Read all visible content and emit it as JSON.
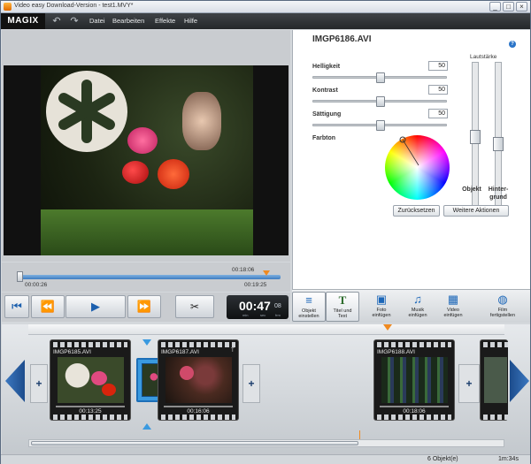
{
  "window": {
    "title": "Video easy Download-Version - test1.MVY*",
    "controls": [
      "_",
      "□",
      "×"
    ]
  },
  "menubar": {
    "logo": "MAGIX",
    "undo_icon": "undo-icon",
    "redo_icon": "redo-icon",
    "items": [
      "Datei",
      "Bearbeiten",
      "Effekte",
      "Hilfe"
    ]
  },
  "seek": {
    "top_time": "00:18:06",
    "start_time": "00:00:26",
    "end_time": "00:19:25",
    "position": 0.96
  },
  "transport": {
    "buttons": [
      "⏮",
      "⏪",
      "▶",
      "⏩"
    ],
    "icons": [
      "skip-start-icon",
      "rewind-icon",
      "play-icon",
      "fast-forward-icon"
    ],
    "cut_icon": "scissors-icon"
  },
  "lcd": {
    "time": "00:47",
    "frame": "08",
    "labels": [
      "min",
      "sec",
      "frm"
    ]
  },
  "properties": {
    "clip_name": "IMGP6186.AVI",
    "help": "?",
    "sliders": [
      {
        "label": "Helligkeit",
        "value": "50",
        "level": 0.5
      },
      {
        "label": "Kontrast",
        "value": "50",
        "level": 0.5
      },
      {
        "label": "Sättigung",
        "value": "50",
        "level": 0.5
      }
    ],
    "hue_label": "Farbton",
    "volume": {
      "title": "Lautstärke",
      "object_label": "Objekt",
      "bg_label_1": "Hinter-",
      "bg_label_2": "grund",
      "object_level": 0.5,
      "bg_level": 0.45
    },
    "reset_button": "Zurücksetzen",
    "more_button": "Weitere Aktionen"
  },
  "toolbar": {
    "items": [
      {
        "line1": "Objekt",
        "line2": "einstellen",
        "icon": "adjust-icon"
      },
      {
        "line1": "Titel und",
        "line2": "Text",
        "icon": "title-icon"
      },
      {
        "line1": "Foto",
        "line2": "einfügen",
        "icon": "photo-insert-icon"
      },
      {
        "line1": "Musik",
        "line2": "einfügen",
        "icon": "music-insert-icon"
      },
      {
        "line1": "Video",
        "line2": "einfügen",
        "icon": "video-insert-icon"
      },
      {
        "line1": "Film",
        "line2": "fertigstellen",
        "icon": "globe-icon"
      }
    ]
  },
  "timeline": {
    "clips": [
      {
        "name": "IMGP6185.AVI",
        "duration": "00:13:25"
      },
      {
        "name": "IMGP6187.AVI",
        "duration": "00:16:06"
      },
      {
        "name": "IMGP6188.AVI",
        "duration": "00:18:06"
      }
    ],
    "plus": "+"
  },
  "status": {
    "objects": "6 Objekt(e)",
    "duration": "1m:34s"
  },
  "colors": {
    "accent": "#1b66b8",
    "playhead": "#f08a20",
    "transition": "#3a9ae0"
  }
}
